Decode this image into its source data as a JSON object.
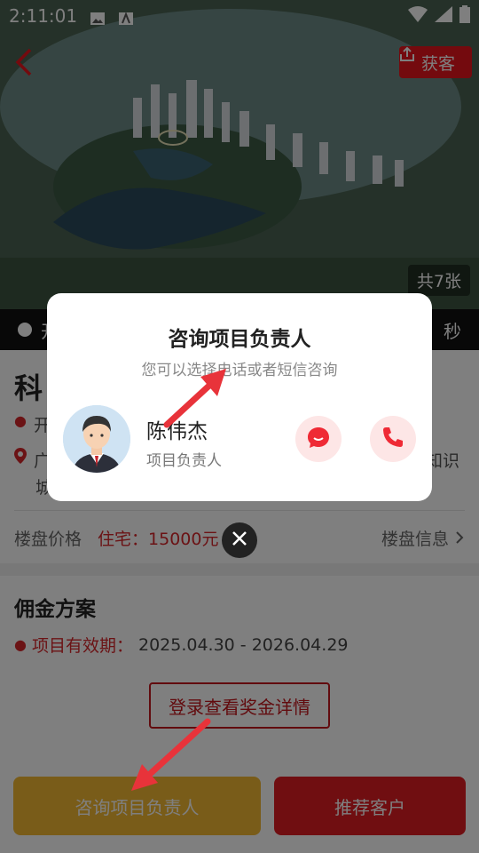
{
  "status_bar": {
    "time": "2:11:01"
  },
  "header": {
    "share_label": "获客",
    "photo_count": "共7张"
  },
  "countdown": {
    "prefix": "开",
    "suffix": "秒"
  },
  "project": {
    "name_partial": "科",
    "open_partial": "开",
    "address_partial_line1": "广",
    "address_partial_right": "知识",
    "address_partial_line2": "城"
  },
  "price": {
    "label": "楼盘价格",
    "value": "住宅：15000元",
    "more_label": "楼盘信息"
  },
  "commission": {
    "title": "佣金方案",
    "validity_label": "项目有效期：",
    "validity_value": "2025.04.30 - 2026.04.29",
    "login_button": "登录查看奖金详情"
  },
  "bottom": {
    "consult_button": "咨询项目负责人",
    "recommend_button": "推荐客户"
  },
  "dialog": {
    "title": "咨询项目负责人",
    "subtitle": "您可以选择电话或者短信咨询",
    "person_name": "陈伟杰",
    "person_role": "项目负责人"
  },
  "colors": {
    "accent_red": "#e11d22",
    "gold": "#f3b832",
    "annotation_red": "#e8333a"
  }
}
